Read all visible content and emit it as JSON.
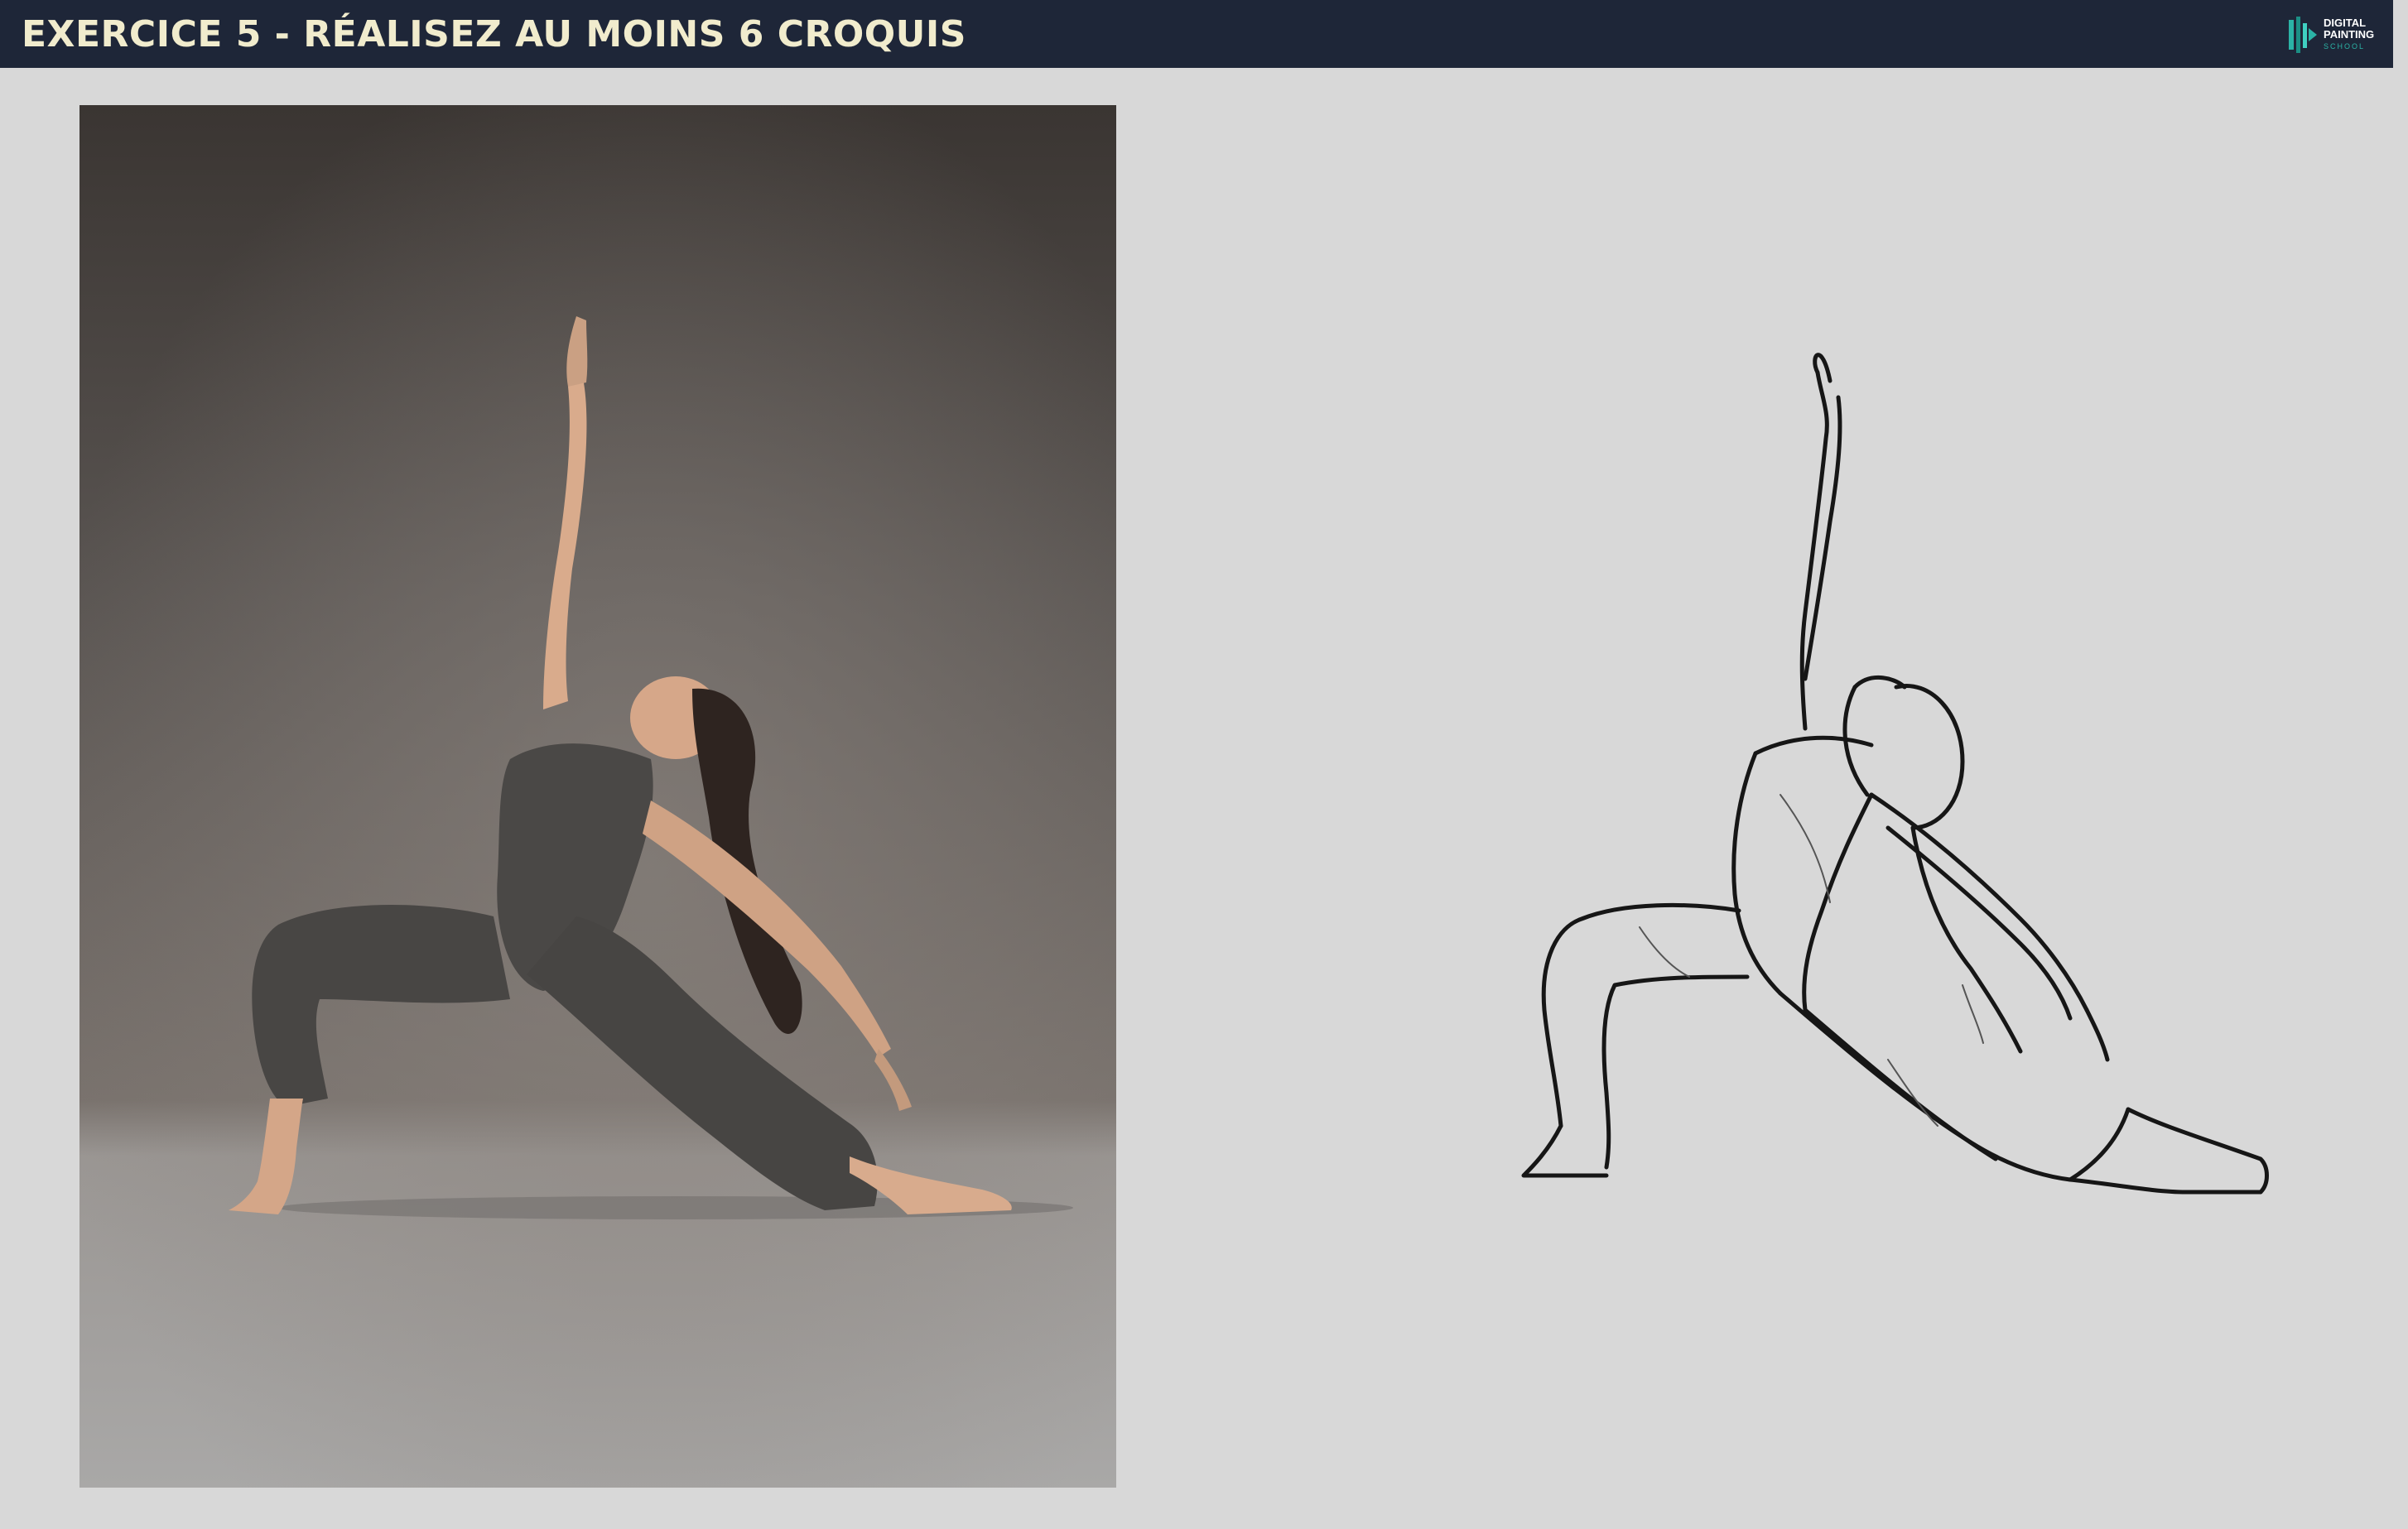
{
  "header": {
    "title": "EXERCICE 5 - RÉALISEZ AU MOINS 6 CROQUIS",
    "logo": {
      "line1": "DIGITAL",
      "line2": "PAINTING",
      "line3": "SCHOOL"
    }
  },
  "colors": {
    "header_bg": "#1e2638",
    "title_text": "#f1eccd",
    "page_bg": "#d8d8d8",
    "logo_accent": "#2bb3a6"
  },
  "reference_photo": {
    "icon": "dancer-photo"
  },
  "sketch": {
    "icon": "dancer-line-sketch"
  }
}
